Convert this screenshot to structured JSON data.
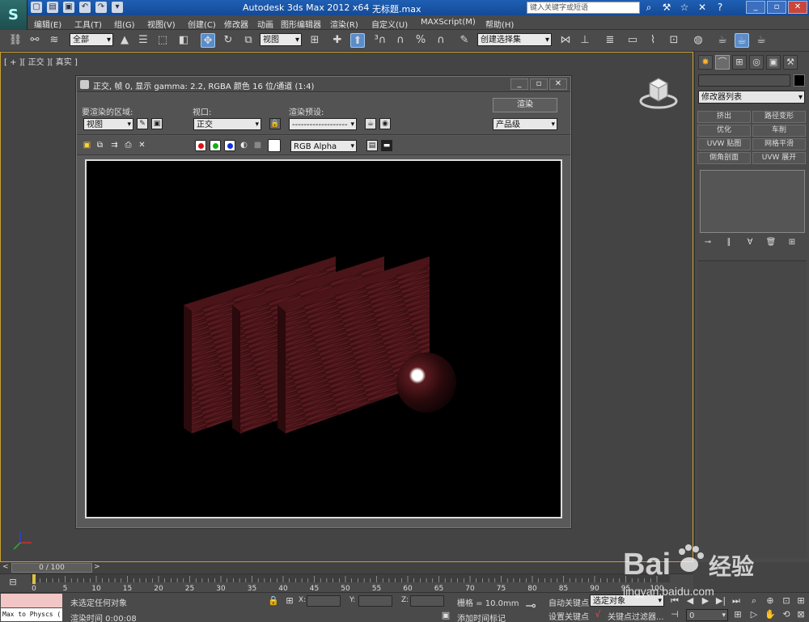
{
  "app": {
    "logo_glyph": "S",
    "title": "Autodesk 3ds Max  2012 x64",
    "file": "无标题.max",
    "search_placeholder": "键入关键字或短语",
    "window_buttons": [
      "_",
      "▫",
      "✕"
    ]
  },
  "menu": [
    "编辑(E)",
    "工具(T)",
    "组(G)",
    "视图(V)",
    "创建(C)",
    "修改器",
    "动画",
    "图形编辑器",
    "渲染(R)",
    "自定义(U)",
    "MAXScript(M)",
    "帮助(H)"
  ],
  "toolbar": {
    "selection_filter": "全部",
    "reference_coord": "视图",
    "named_selection": "创建选择集"
  },
  "viewport": {
    "label": "[ + ][ 正交 ][ 真实 ]"
  },
  "render_window": {
    "title": "正交, 帧 0, 显示 gamma: 2.2, RGBA 颜色 16 位/通道 (1:4)",
    "area_label": "要渲染的区域:",
    "area_value": "视图",
    "viewport_label": "视口:",
    "viewport_value": "正交",
    "preset_label": "渲染预设:",
    "preset_value": "-------------------",
    "render_button": "渲染",
    "quality_value": "产品级",
    "channel_value": "RGB Alpha",
    "colors": {
      "red": "#e01010",
      "green": "#10b010",
      "blue": "#1030e0"
    }
  },
  "command_panel": {
    "modifier_list": "修改器列表",
    "modifier_buttons": [
      "挤出",
      "路径变形",
      "优化",
      "车削",
      "UVW 贴图",
      "网格平滑",
      "倒角剖面",
      "UVW 展开"
    ]
  },
  "timeline": {
    "frame_display": "0 / 100",
    "ticks": [
      "0",
      "5",
      "10",
      "15",
      "20",
      "25",
      "30",
      "35",
      "40",
      "45",
      "50",
      "55",
      "60",
      "65",
      "70",
      "75",
      "80",
      "85",
      "90",
      "95",
      "100"
    ]
  },
  "status": {
    "maxscript_output": "Max to Physcs (",
    "selection_status": "未选定任何对象",
    "render_time": "渲染时间  0:00:08",
    "x_label": "X:",
    "y_label": "Y:",
    "z_label": "Z:",
    "grid": "栅格 = 10.0mm",
    "add_time_tag": "添加时间标记",
    "auto_key": "自动关键点",
    "set_key": "设置关键点",
    "selected_object": "选定对象",
    "key_filters": "关键点过滤器...",
    "frame_field": "0"
  },
  "watermark": {
    "brand": "Bai",
    "brand_cn": "经验",
    "url": "jingyan.baidu.com"
  }
}
